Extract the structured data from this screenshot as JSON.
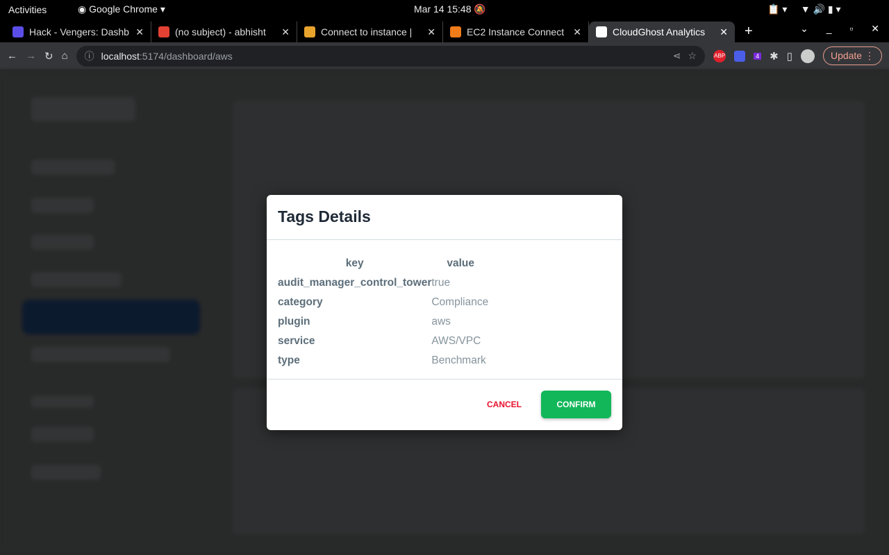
{
  "system": {
    "activities": "Activities",
    "app": "Google Chrome",
    "datetime": "Mar 14  15:48"
  },
  "tabs": [
    {
      "title": "Hack - Vengers: Dashb",
      "color": "#5b4ee8"
    },
    {
      "title": "(no subject) - abhisht",
      "color": "#e34133"
    },
    {
      "title": "Connect to instance |",
      "color": "#e8a32c"
    },
    {
      "title": "EC2 Instance Connect",
      "color": "#f07d1a"
    },
    {
      "title": "CloudGhost Analytics",
      "color": "#ffffff"
    }
  ],
  "address": {
    "host": "localhost",
    "rest": ":5174/dashboard/aws"
  },
  "toolbar": {
    "update_label": "Update",
    "ext_badge": "4"
  },
  "modal": {
    "title": "Tags Details",
    "headers": [
      "key",
      "value"
    ],
    "rows": [
      {
        "key": "audit_manager_control_tower",
        "value": "true"
      },
      {
        "key": "category",
        "value": "Compliance"
      },
      {
        "key": "plugin",
        "value": "aws"
      },
      {
        "key": "service",
        "value": "AWS/VPC"
      },
      {
        "key": "type",
        "value": "Benchmark"
      }
    ],
    "cancel": "CANCEL",
    "confirm": "CONFIRM"
  }
}
